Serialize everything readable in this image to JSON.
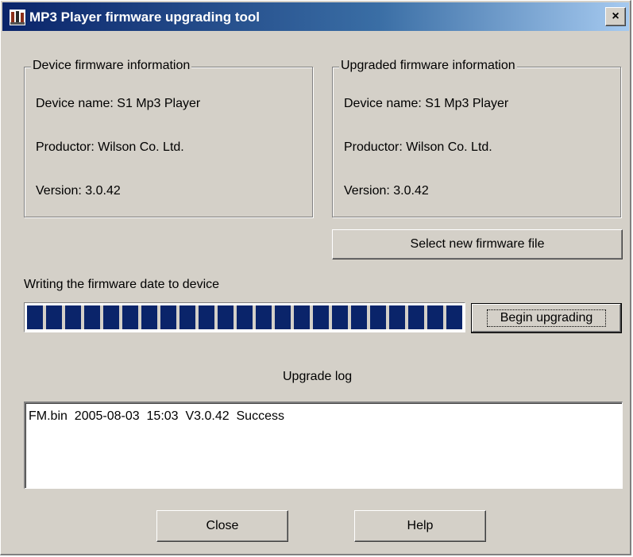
{
  "window": {
    "title": "MP3 Player firmware upgrading tool",
    "close_label": "×"
  },
  "device_info": {
    "legend": "Device firmware information",
    "name": "Device name: S1 Mp3 Player",
    "producer": "Productor: Wilson Co. Ltd.",
    "version": "Version: 3.0.42"
  },
  "upgraded_info": {
    "legend": "Upgraded firmware information",
    "name": "Device name: S1 Mp3 Player",
    "producer": "Productor: Wilson Co. Ltd.",
    "version": "Version: 3.0.42"
  },
  "select_file_label": "Select new firmware file",
  "status_text": "Writing the firmware date to device",
  "progress_fraction": 1.0,
  "begin_label": "Begin upgrading",
  "log": {
    "title": "Upgrade log",
    "entries": [
      "FM.bin  2005-08-03  15:03  V3.0.42  Success"
    ]
  },
  "close_button_label": "Close",
  "help_button_label": "Help",
  "colors": {
    "title_bar": "#0a246a",
    "progress_fill": "#0a246a",
    "face": "#d4d0c8"
  },
  "icons": {
    "app": "app-icon",
    "close": "close-icon"
  }
}
